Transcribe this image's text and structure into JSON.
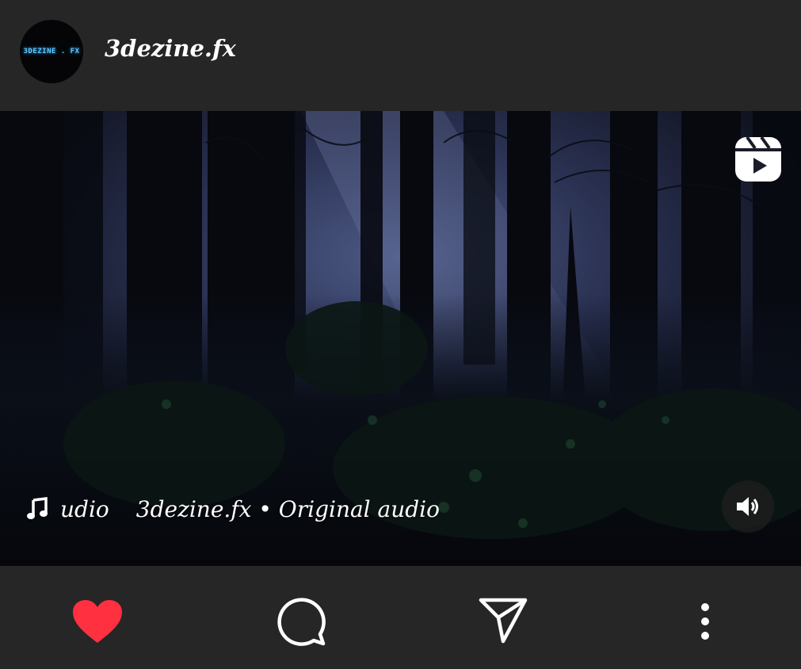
{
  "post": {
    "username": "3dezine.fx",
    "avatar_text": "3DEZINE . FX",
    "audio_partial": "udio",
    "audio_label": "3dezine.fx • Original audio"
  },
  "icons": {
    "reel": "reels-icon",
    "music": "music-note-icon",
    "sound": "speaker-icon",
    "like": "heart-icon",
    "comment": "comment-icon",
    "share": "send-icon",
    "more": "more-vertical-icon"
  },
  "colors": {
    "background": "#262626",
    "like_active": "#ff3040",
    "avatar_text": "#5fc8ff"
  }
}
